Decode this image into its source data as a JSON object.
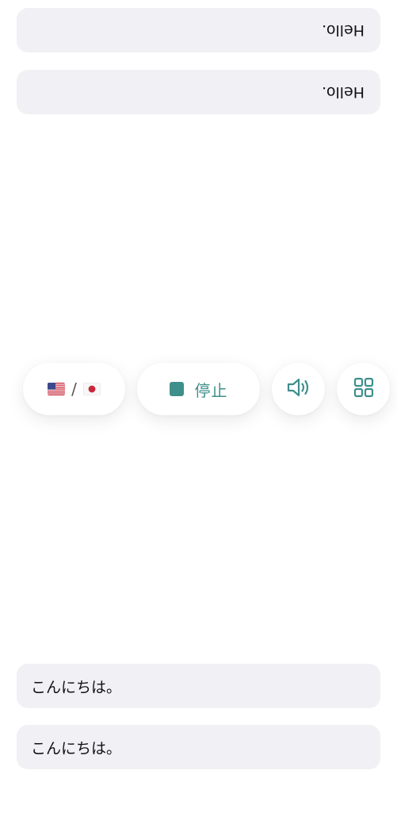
{
  "top_messages": [
    {
      "text": "Hello."
    },
    {
      "text": "Hello."
    }
  ],
  "bottom_messages": [
    {
      "text": "こんにちは。"
    },
    {
      "text": "こんにちは。"
    }
  ],
  "toolbar": {
    "language_separator": "/",
    "language_flags": [
      "us-flag-icon",
      "jp-flag-icon"
    ],
    "stop_label": "停止",
    "speaker_icon": "speaker-icon",
    "grid_icon": "grid-icon"
  },
  "colors": {
    "accent": "#3e8f8c",
    "bubble_bg": "#f1f1f5"
  }
}
